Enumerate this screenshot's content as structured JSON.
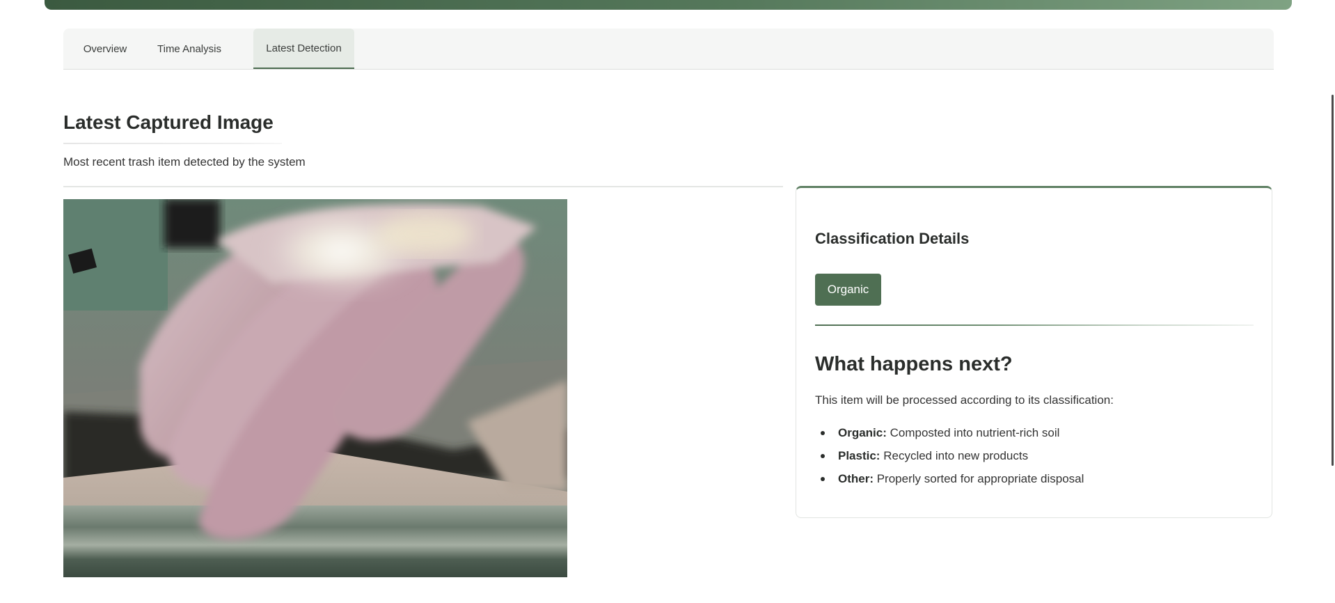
{
  "tabs": [
    {
      "label": "Overview"
    },
    {
      "label": "Time Analysis"
    },
    {
      "label": "Latest Detection"
    }
  ],
  "active_tab": "Latest Detection",
  "section": {
    "title": "Latest Captured Image",
    "subtitle": "Most recent trash item detected by the system"
  },
  "classification": {
    "heading": "Classification Details",
    "badge": "Organic",
    "next_title": "What happens next?",
    "next_desc": "This item will be processed according to its classification:",
    "items": [
      {
        "label": "Organic:",
        "text": " Composted into nutrient-rich soil"
      },
      {
        "label": "Plastic:",
        "text": " Recycled into new products"
      },
      {
        "label": "Other:",
        "text": " Properly sorted for appropriate disposal"
      }
    ]
  },
  "colors": {
    "accent": "#4f6f53",
    "banner_start": "#3b5a40",
    "banner_end": "#7fa283"
  },
  "icons": {
    "captured_image": "webcam-photo"
  }
}
